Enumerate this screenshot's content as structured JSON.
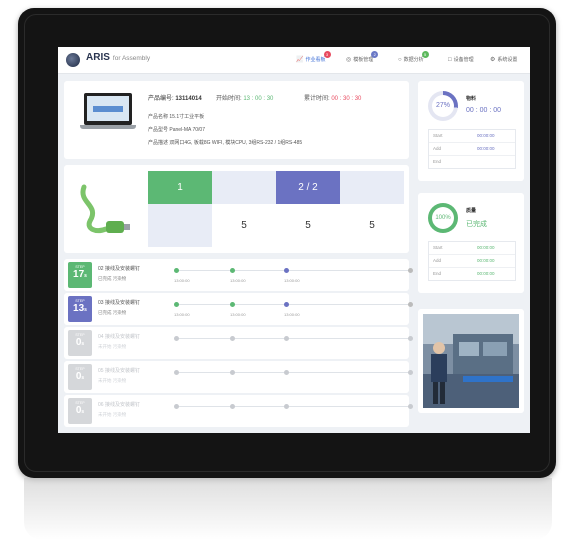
{
  "app": {
    "brand": "ARIS",
    "brand_sub": "for Assembly"
  },
  "nav": [
    {
      "label": "作业看板",
      "icon": "chart-icon",
      "badge": "3",
      "badge_color": "#e84a5f",
      "active": true
    },
    {
      "label": "模板管理",
      "icon": "layers-icon",
      "badge": "2",
      "badge_color": "#6b79c6",
      "active": false
    },
    {
      "label": "数据分析",
      "icon": "analytics-icon",
      "badge": "5",
      "badge_color": "#5cb85c",
      "active": false
    },
    {
      "label": "设备管理",
      "icon": "device-icon",
      "badge": "",
      "badge_color": "",
      "active": false
    },
    {
      "label": "系统设置",
      "icon": "gear-icon",
      "badge": "",
      "badge_color": "",
      "active": false
    }
  ],
  "product": {
    "code_label": "产品编号:",
    "code": "13114014",
    "plan_label": "开始时间:",
    "plan_time": "13 : 00 : 30",
    "elapsed_label": "累计时间:",
    "elapsed_time": "00 : 30 : 30",
    "line1": "产品名称  15.1寸工业平板",
    "line2": "产品型号  Panel-MA 70/07",
    "line3": "产品描述  双网口4G, 板载8G WIFI, 模块CPU, 3组RS-232 / 1组RS-485"
  },
  "stages": {
    "top": [
      "1",
      "2 / 2",
      ""
    ],
    "bottom": [
      "",
      "5",
      "5",
      "5"
    ]
  },
  "status_card1": {
    "gauge": "27%",
    "title": "物料",
    "timer": "00 : 00 : 00",
    "rows": [
      {
        "label": "Start",
        "value": "00:00:00"
      },
      {
        "label": "Add",
        "value": "00:00:00"
      },
      {
        "label": "End",
        "value": ""
      }
    ]
  },
  "status_card2": {
    "gauge": "100%",
    "title": "质量",
    "status": "已完成",
    "rows": [
      {
        "label": "Start",
        "value": "00:00:00"
      },
      {
        "label": "Add",
        "value": "00:00:00"
      },
      {
        "label": "End",
        "value": "00:00:00"
      }
    ]
  },
  "steps": [
    {
      "tag": "STEP",
      "num": "17",
      "unit": "s",
      "color": "#5cb874",
      "title": "02 接线及安装螺钉",
      "sub": "已完成  污染物",
      "times": [
        "13:00:00",
        "13:00:00",
        "13:00:00"
      ],
      "active": true
    },
    {
      "tag": "STEP",
      "num": "13",
      "unit": "s",
      "color": "#6b72c2",
      "title": "03 接线及安装螺钉",
      "sub": "已完成  污染物",
      "times": [
        "13:00:00",
        "13:00:00",
        "13:00:00"
      ],
      "active": true
    },
    {
      "tag": "STEP",
      "num": "0",
      "unit": "s",
      "color": "#d5d7da",
      "title": "04 接线及安装螺钉",
      "sub": "未开始  污染物",
      "times": [
        "",
        "",
        ""
      ],
      "active": false
    },
    {
      "tag": "STEP",
      "num": "0",
      "unit": "s",
      "color": "#d5d7da",
      "title": "05 接线及安装螺钉",
      "sub": "未开始  污染物",
      "times": [
        "",
        "",
        ""
      ],
      "active": false
    },
    {
      "tag": "STEP",
      "num": "0",
      "unit": "s",
      "color": "#d5d7da",
      "title": "06 接线及安装螺钉",
      "sub": "未开始  污染物",
      "times": [
        "",
        "",
        ""
      ],
      "active": false
    }
  ],
  "colors": {
    "green": "#5cb874",
    "purple": "#6b72c2",
    "red": "#e84a5f",
    "accent_blue": "#3d6ed6"
  }
}
